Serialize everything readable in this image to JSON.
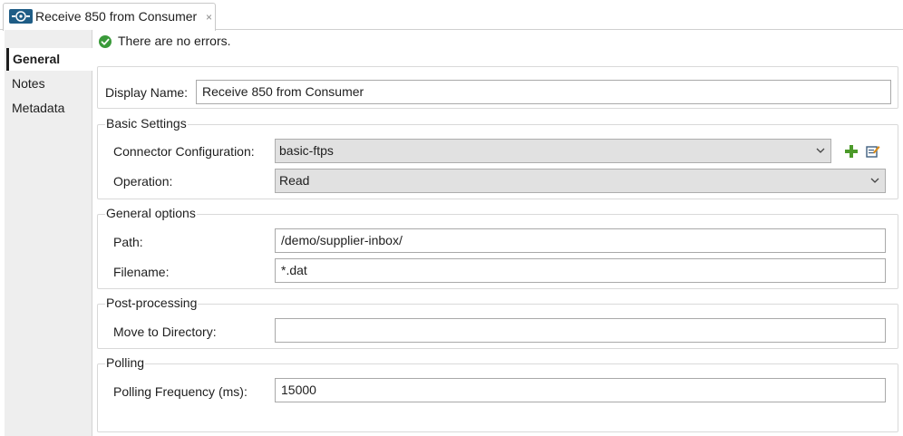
{
  "tab": {
    "title": "Receive 850 from Consumer",
    "close": "×",
    "icon": "connector-icon"
  },
  "nav": {
    "items": [
      {
        "label": "General",
        "active": true
      },
      {
        "label": "Notes",
        "active": false
      },
      {
        "label": "Metadata",
        "active": false
      }
    ]
  },
  "status": {
    "text": "There are no errors.",
    "icon": "check-circle-icon",
    "color": "#3a9a3a"
  },
  "general": {
    "display_name_label": "Display Name:",
    "display_name_value": "Receive 850 from Consumer"
  },
  "basic_settings": {
    "legend": "Basic Settings",
    "connector_label": "Connector Configuration:",
    "connector_value": "basic-ftps",
    "operation_label": "Operation:",
    "operation_value": "Read",
    "add_icon": "plus-icon",
    "edit_icon": "edit-icon"
  },
  "general_options": {
    "legend": "General options",
    "path_label": "Path:",
    "path_value": "/demo/supplier-inbox/",
    "filename_label": "Filename:",
    "filename_value": "*.dat"
  },
  "post_processing": {
    "legend": "Post-processing",
    "move_label": "Move to Directory:",
    "move_value": ""
  },
  "polling": {
    "legend": "Polling",
    "frequency_label": "Polling Frequency (ms):",
    "frequency_value": "15000"
  },
  "colors": {
    "accent_green": "#3a9a3a",
    "combo_bg": "#e1e1e1",
    "nav_bg": "#eeeeee"
  }
}
